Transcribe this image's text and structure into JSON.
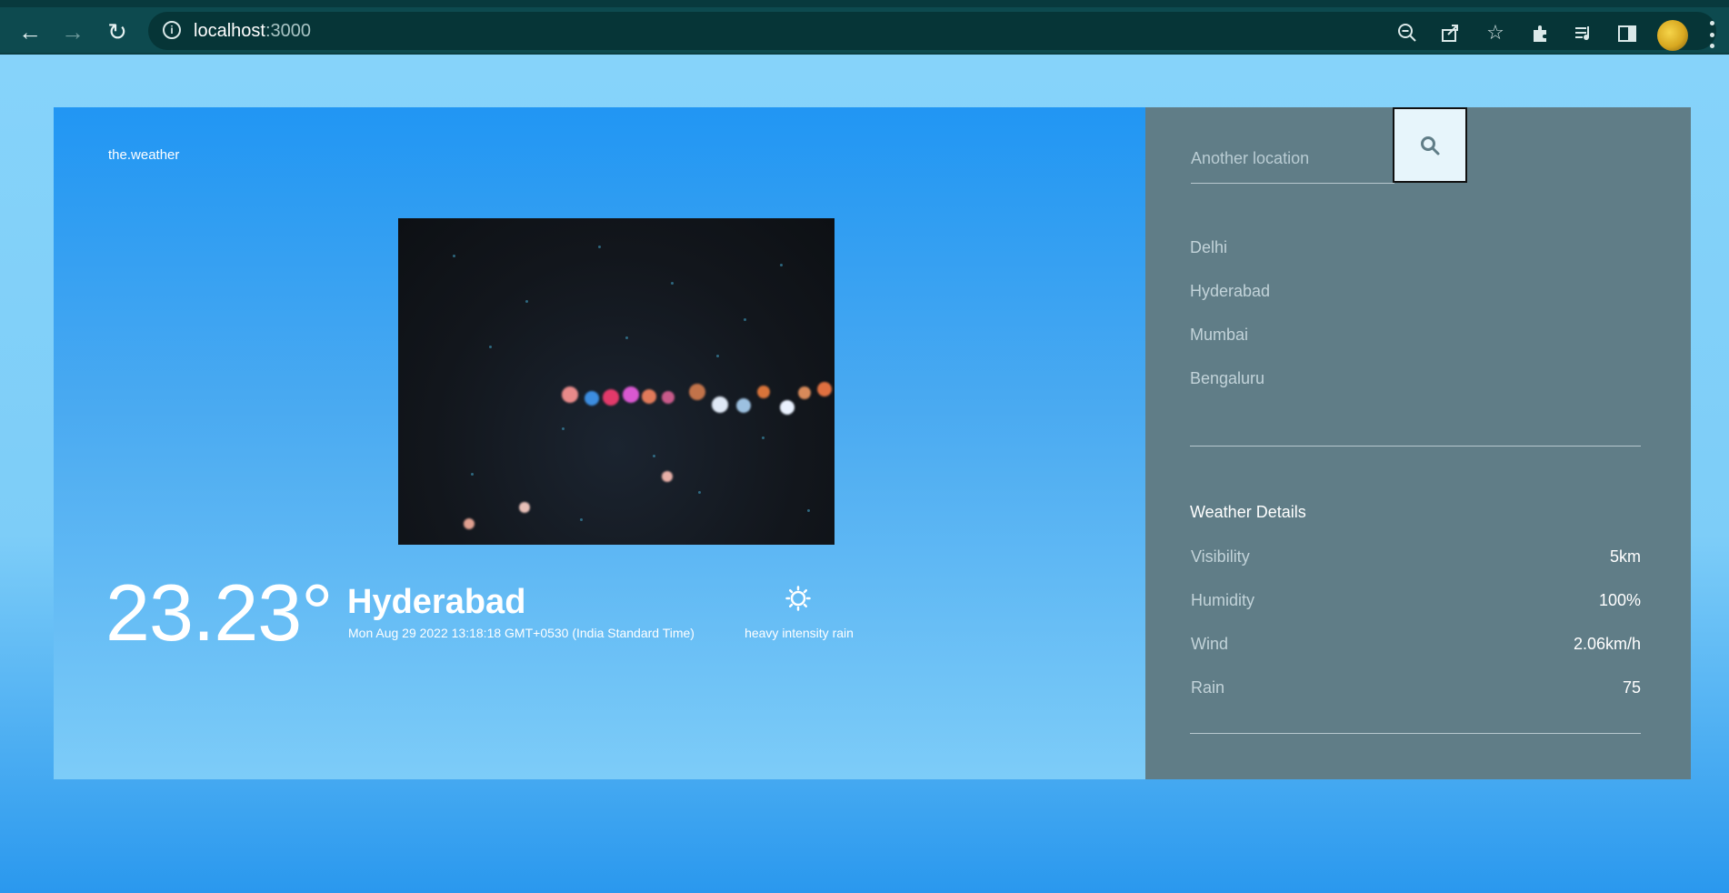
{
  "browser": {
    "url_host": "localhost",
    "url_port": ":3000"
  },
  "app": {
    "brand": "the.weather",
    "temperature": "23.23°",
    "city": "Hyderabad",
    "datetime": "Mon Aug 29 2022 13:18:18 GMT+0530 (India Standard Time)",
    "condition": "heavy intensity rain",
    "condition_icon": "sun-icon"
  },
  "sidebar": {
    "search_placeholder": "Another location",
    "cities": [
      "Delhi",
      "Hyderabad",
      "Mumbai",
      "Bengaluru"
    ],
    "details_title": "Weather Details",
    "details": [
      {
        "label": "Visibility",
        "value": "5km"
      },
      {
        "label": "Humidity",
        "value": "100%"
      },
      {
        "label": "Wind",
        "value": "2.06km/h"
      },
      {
        "label": "Rain",
        "value": "75"
      }
    ]
  },
  "colors": {
    "main_gradient_top": "#2196f3",
    "main_gradient_bottom": "#7dccf8",
    "sidebar_bg": "#607d87",
    "browser_bar": "#0d4a4f"
  }
}
